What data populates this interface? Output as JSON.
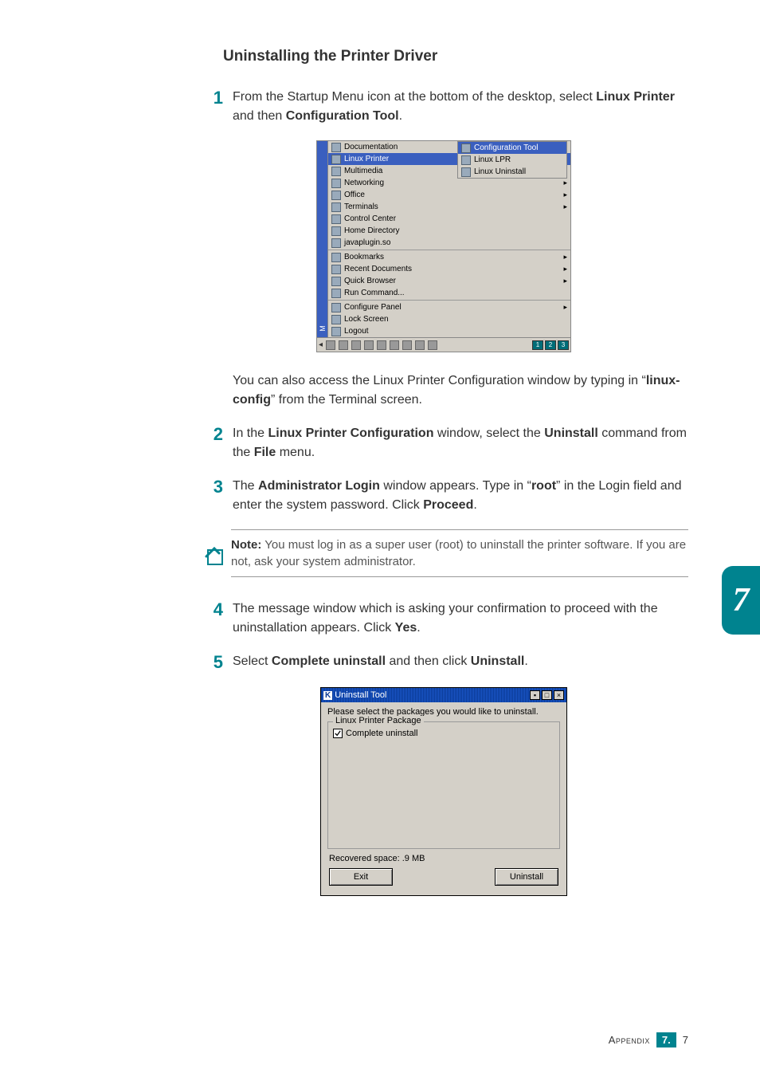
{
  "section_title": "Uninstalling the Printer Driver",
  "steps": {
    "s1": {
      "num": "1",
      "t1": "From the Startup Menu icon at the bottom of the desktop, select ",
      "b1": "Linux Printer",
      "t2": " and then ",
      "b2": "Configuration Tool",
      "t3": "."
    },
    "s1_follow": {
      "t1": "You can also access the Linux Printer Configuration window by typing in “",
      "b1": "linux-config",
      "t2": "” from the Terminal screen."
    },
    "s2": {
      "num": "2",
      "t1": "In the ",
      "b1": "Linux Printer Configuration",
      "t2": " window, select the ",
      "b2": "Uninstall",
      "t3": " command from the ",
      "b3": "File",
      "t4": " menu."
    },
    "s3": {
      "num": "3",
      "t1": "The ",
      "b1": "Administrator Login",
      "t2": " window appears. Type in “",
      "b2": "root",
      "t3": "” in the Login field and enter the system password. Click ",
      "b3": "Proceed",
      "t4": "."
    },
    "s4": {
      "num": "4",
      "t1": "The message window which is asking your confirmation to proceed with the uninstallation appears. Click ",
      "b1": "Yes",
      "t2": "."
    },
    "s5": {
      "num": "5",
      "t1": "Select ",
      "b1": "Complete uninstall",
      "t2": " and then click ",
      "b2": "Uninstall",
      "t3": "."
    }
  },
  "note": {
    "label": "Note:",
    "text": " You must log in as a super user (root) to uninstall the printer software. If you are not, ask your system administrator."
  },
  "kde": {
    "sidebar": "M",
    "items": [
      {
        "label": "Documentation",
        "arrow": true
      },
      {
        "label": "Linux Printer",
        "arrow": true,
        "hl": true
      },
      {
        "label": "Multimedia",
        "arrow": true
      },
      {
        "label": "Networking",
        "arrow": true
      },
      {
        "label": "Office",
        "arrow": true
      },
      {
        "label": "Terminals",
        "arrow": true
      },
      {
        "label": "Control Center"
      },
      {
        "label": "Home Directory"
      },
      {
        "label": "javaplugin.so"
      }
    ],
    "items2": [
      {
        "label": "Bookmarks",
        "arrow": true
      },
      {
        "label": "Recent Documents",
        "arrow": true
      },
      {
        "label": "Quick Browser",
        "arrow": true
      },
      {
        "label": "Run Command..."
      }
    ],
    "items3": [
      {
        "label": "Configure Panel",
        "arrow": true
      },
      {
        "label": "Lock Screen"
      },
      {
        "label": "Logout"
      }
    ],
    "submenu": [
      {
        "label": "Configuration Tool",
        "hl": true
      },
      {
        "label": "Linux LPR"
      },
      {
        "label": "Linux Uninstall"
      }
    ],
    "workspaces": [
      "1",
      "2",
      "3"
    ]
  },
  "uninst": {
    "title": "Uninstall Tool",
    "k": "K",
    "msg": "Please select the packages you would like to uninstall.",
    "group_title": "Linux Printer Package",
    "check_label": "Complete uninstall",
    "space": "Recovered space:  .9 MB",
    "btn_exit": "Exit",
    "btn_uninstall": "Uninstall"
  },
  "side_tab": "7",
  "footer": {
    "appendix": "Appendix",
    "chapter": "7.",
    "page": "7"
  }
}
